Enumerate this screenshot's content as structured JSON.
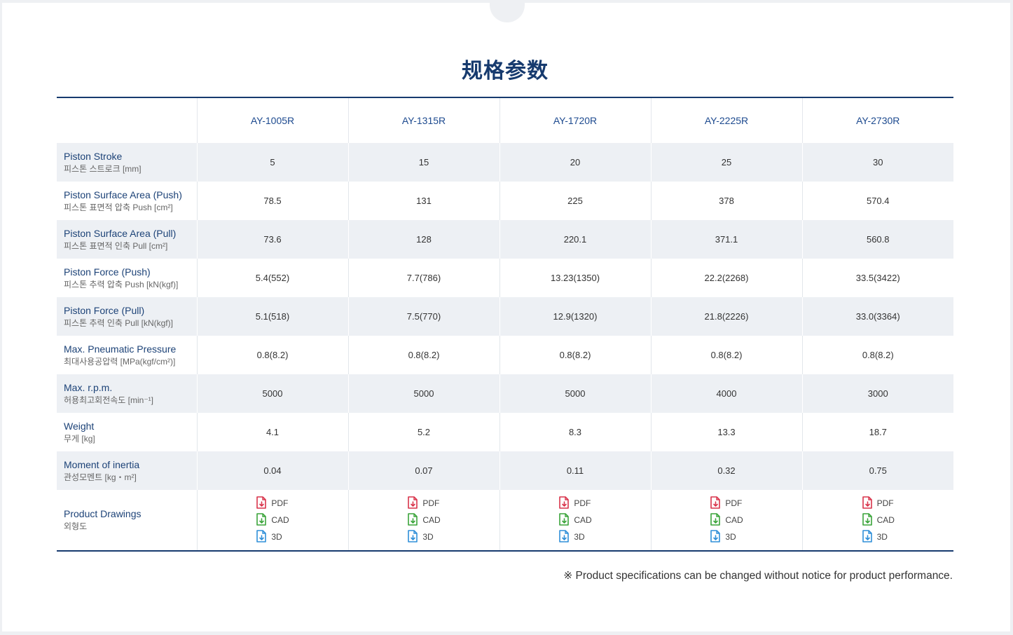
{
  "title": "规格参数",
  "models": [
    "AY-1005R",
    "AY-1315R",
    "AY-1720R",
    "AY-2225R",
    "AY-2730R"
  ],
  "rows": [
    {
      "en": "Piston Stroke",
      "ko": "피스톤 스트로크 [mm]",
      "values": [
        "5",
        "15",
        "20",
        "25",
        "30"
      ]
    },
    {
      "en": "Piston Surface Area (Push)",
      "ko": "피스톤 표면적 압축 Push [cm²]",
      "values": [
        "78.5",
        "131",
        "225",
        "378",
        "570.4"
      ]
    },
    {
      "en": "Piston Surface Area (Pull)",
      "ko": "피스톤 표면적 인축 Pull [cm²]",
      "values": [
        "73.6",
        "128",
        "220.1",
        "371.1",
        "560.8"
      ]
    },
    {
      "en": "Piston Force (Push)",
      "ko": "피스톤 추력 압축 Push [kN(kgf)]",
      "values": [
        "5.4(552)",
        "7.7(786)",
        "13.23(1350)",
        "22.2(2268)",
        "33.5(3422)"
      ]
    },
    {
      "en": "Piston Force (Pull)",
      "ko": "피스톤 추력 인축 Pull [kN(kgf)]",
      "values": [
        "5.1(518)",
        "7.5(770)",
        "12.9(1320)",
        "21.8(2226)",
        "33.0(3364)"
      ]
    },
    {
      "en": "Max. Pneumatic Pressure",
      "ko": "최대사용공압력 [MPa(kgf/cm²)]",
      "values": [
        "0.8(8.2)",
        "0.8(8.2)",
        "0.8(8.2)",
        "0.8(8.2)",
        "0.8(8.2)"
      ]
    },
    {
      "en": "Max. r.p.m.",
      "ko": "허용최고회전속도 [min⁻¹]",
      "values": [
        "5000",
        "5000",
        "5000",
        "4000",
        "3000"
      ]
    },
    {
      "en": "Weight",
      "ko": "무게 [kg]",
      "values": [
        "4.1",
        "5.2",
        "8.3",
        "13.3",
        "18.7"
      ]
    },
    {
      "en": "Moment of inertia",
      "ko": "관성모멘트 [kg・m²]",
      "values": [
        "0.04",
        "0.07",
        "0.11",
        "0.32",
        "0.75"
      ]
    }
  ],
  "drawings": {
    "en": "Product Drawings",
    "ko": "외형도",
    "links": [
      {
        "label": "PDF",
        "icon": "pdf-download-icon",
        "color": "#d9344b"
      },
      {
        "label": "CAD",
        "icon": "cad-download-icon",
        "color": "#3aa43a"
      },
      {
        "label": "3D",
        "icon": "3d-download-icon",
        "color": "#2f8fd8"
      }
    ]
  },
  "note": "※ Product specifications can be changed without notice for product performance."
}
